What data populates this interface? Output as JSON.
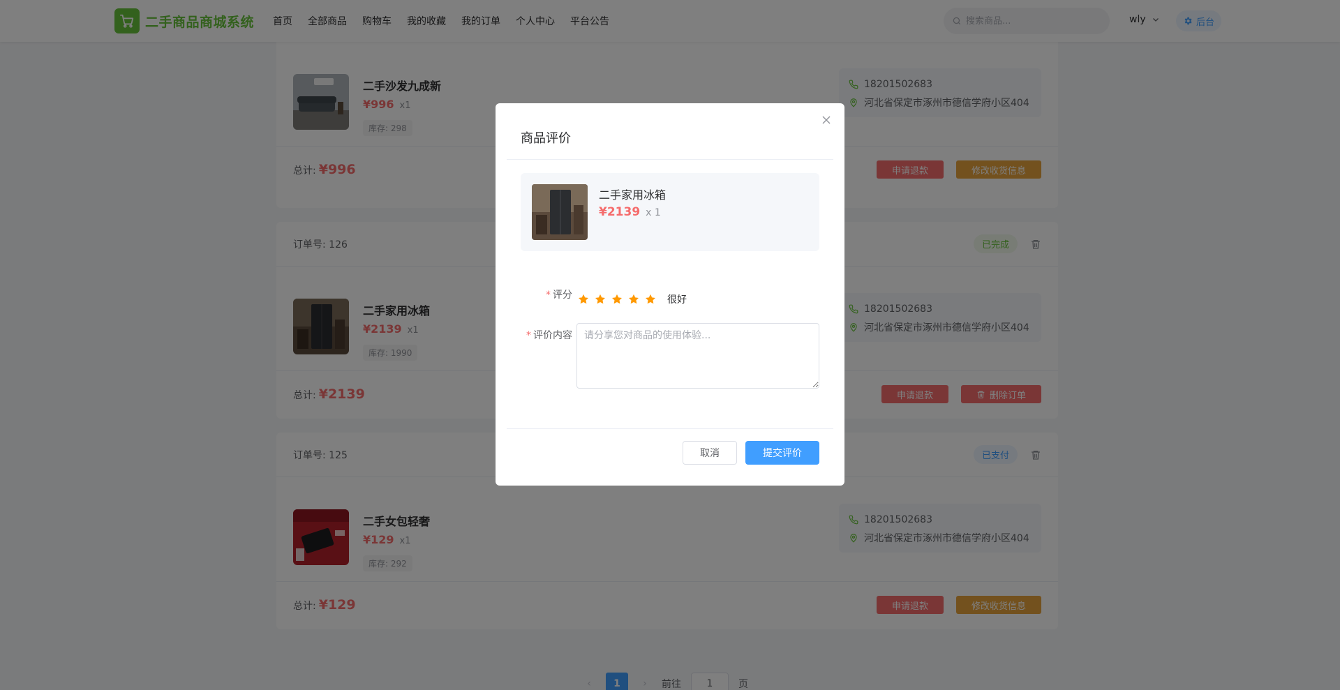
{
  "header": {
    "logo_text": "二手商品商城系统",
    "nav": [
      "首页",
      "全部商品",
      "购物车",
      "我的收藏",
      "我的订单",
      "个人中心",
      "平台公告"
    ],
    "search_placeholder": "搜索商品...",
    "username": "wly",
    "admin_label": "后台"
  },
  "orders": [
    {
      "order_no": "",
      "status": "",
      "product": "二手沙发九成新",
      "price": "¥996",
      "qty": "x1",
      "stock": "库存: 298",
      "phone": "18201502683",
      "address": "河北省保定市涿州市德信学府小区404",
      "total_label": "总计:",
      "total": "¥996",
      "actions": [
        "申请退款",
        "修改收货信息"
      ]
    },
    {
      "order_no": "订单号: 126",
      "status": "已完成",
      "product": "二手家用冰箱",
      "price": "¥2139",
      "qty": "x1",
      "stock": "库存: 1990",
      "phone": "18201502683",
      "address": "河北省保定市涿州市德信学府小区404",
      "total_label": "总计:",
      "total": "¥2139",
      "actions": [
        "申请退款",
        "删除订单"
      ]
    },
    {
      "order_no": "订单号: 125",
      "status": "已支付",
      "product": "二手女包轻奢",
      "price": "¥129",
      "qty": "x1",
      "stock": "库存: 292",
      "phone": "18201502683",
      "address": "河北省保定市涿州市德信学府小区404",
      "total_label": "总计:",
      "total": "¥129",
      "actions": [
        "申请退款",
        "修改收货信息"
      ]
    }
  ],
  "pagination": {
    "current": "1",
    "goto_label": "前往",
    "goto_value": "1",
    "page_suffix": "页"
  },
  "dialog": {
    "title": "商品评价",
    "product_name": "二手家用冰箱",
    "product_price": "¥2139",
    "product_qty": "x 1",
    "rating_label": "评分",
    "rating_value": 5,
    "rating_text": "很好",
    "content_label": "评价内容",
    "content_placeholder": "请分享您对商品的使用体验...",
    "cancel_label": "取消",
    "submit_label": "提交评价"
  },
  "colors": {
    "brand_green": "#67c23a",
    "primary_blue": "#409eff",
    "price_red": "#f56c6c",
    "warning_orange": "#e6a23c",
    "star_orange": "#ff9900"
  }
}
